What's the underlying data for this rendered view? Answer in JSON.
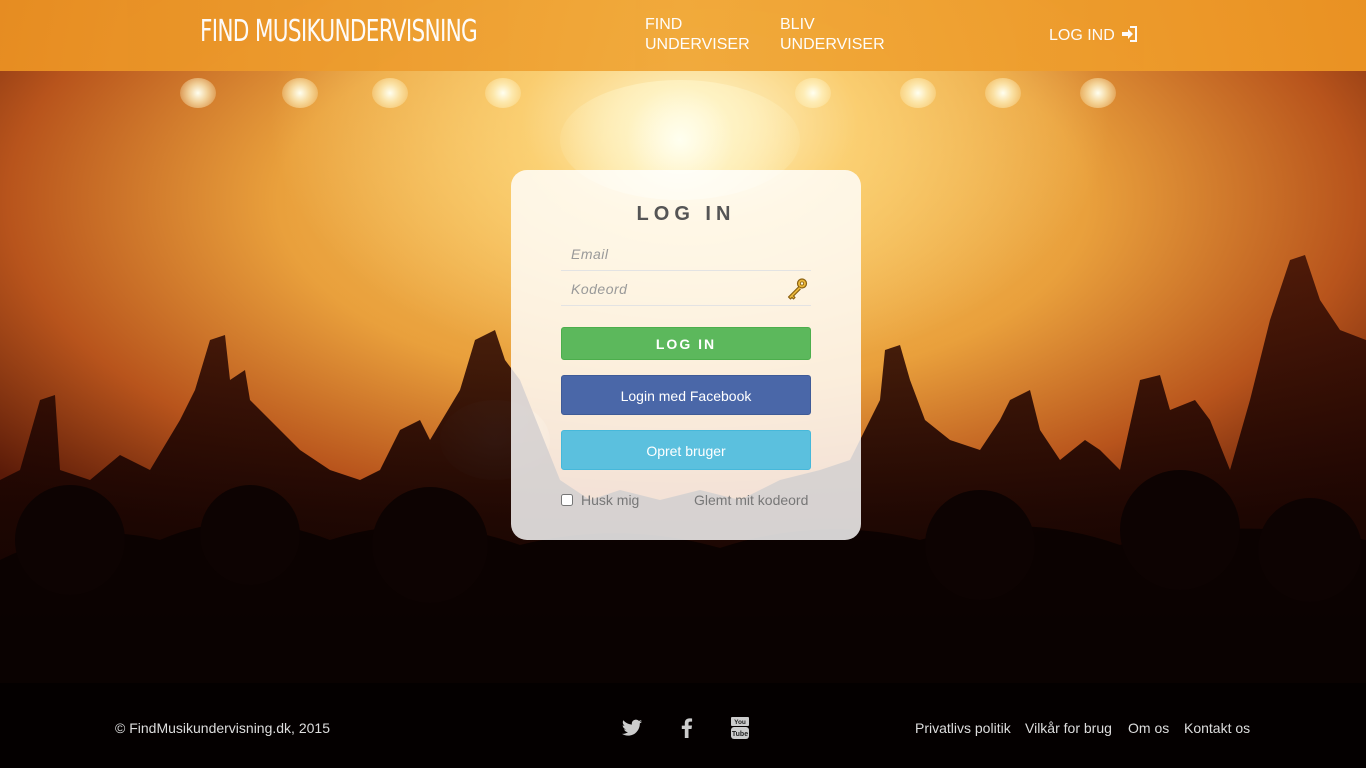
{
  "header": {
    "logo": "FIND MUSIKUNDERVISNING",
    "nav": [
      {
        "label": "FIND UNDERVISER"
      },
      {
        "label": "BLIV UNDERVISER"
      }
    ],
    "login_label": "LOG IND",
    "login_icon": "sign-in-icon"
  },
  "login_panel": {
    "title": "LOG IN",
    "email_placeholder": "Email",
    "password_placeholder": "Kodeord",
    "password_icon": "key-icon",
    "login_button": "LOG IN",
    "facebook_button": "Login med Facebook",
    "create_button": "Opret bruger",
    "remember_label": "Husk mig",
    "forgot_link": "Glemt mit kodeord"
  },
  "footer": {
    "copyright": "© FindMusikundervisning.dk, 2015",
    "social": [
      "twitter-icon",
      "facebook-icon",
      "youtube-icon"
    ],
    "links": [
      "Privatlivs politik",
      "Vilkår for brug",
      "Om os",
      "Kontakt os"
    ]
  },
  "colors": {
    "header": "#f0a535",
    "login_button": "#5cb85c",
    "facebook_button": "#4a67a8",
    "create_button": "#5bc0de"
  }
}
